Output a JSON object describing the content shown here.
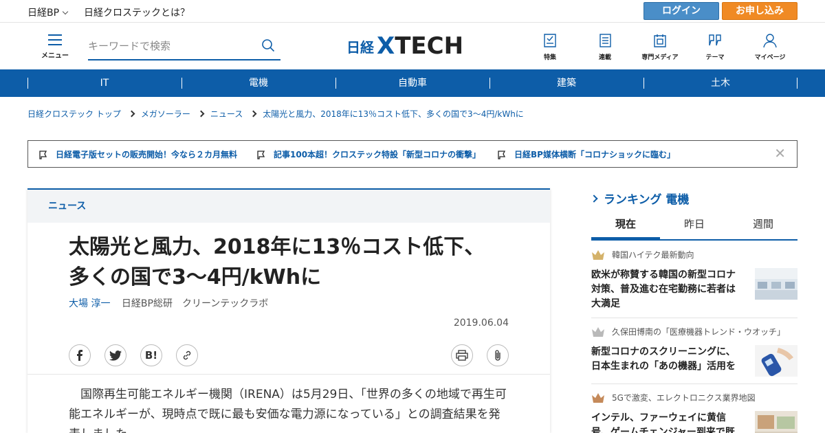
{
  "topbar": {
    "brand_link": "日経BP",
    "about_link": "日経クロステックとは？",
    "login_label": "ログイン",
    "signup_label": "お申し込み"
  },
  "header": {
    "menu_label": "メニュー",
    "search_placeholder": "キーワードで検索",
    "logo_prefix": "日経",
    "logo_x": "X",
    "logo_main": "TECH",
    "nav": [
      {
        "label": "特集",
        "icon": "feature-icon"
      },
      {
        "label": "連載",
        "icon": "series-icon"
      },
      {
        "label": "専門メディア",
        "icon": "media-icon"
      },
      {
        "label": "テーマ",
        "icon": "theme-icon"
      },
      {
        "label": "マイページ",
        "icon": "user-icon"
      }
    ]
  },
  "categories": [
    "IT",
    "電機",
    "自動車",
    "建築",
    "土木"
  ],
  "breadcrumb": [
    "日経クロステック トップ",
    "メガソーラー",
    "ニュース",
    "太陽光と風力、2018年に13％コスト低下、多くの国で3～4円/kWhに"
  ],
  "notices": [
    "日経電子版セットの販売開始！今なら２カ月無料",
    "記事100本超！クロステック特設「新型コロナの衝撃」",
    "日経BP媒体横断「コロナショックに臨む」"
  ],
  "article": {
    "kind": "ニュース",
    "title_line1": "太陽光と風力、2018年に13％コスト低下、",
    "title_line2": "多くの国で3～4円/kWhに",
    "author": "大場 淳一",
    "affiliation": "日経BP総研　クリーンテックラボ",
    "date": "2019.06.04",
    "share_icons": [
      "facebook-icon",
      "twitter-icon",
      "hatena-bookmark-icon",
      "link-icon"
    ],
    "tool_icons": [
      "print-icon",
      "clip-icon"
    ],
    "body": "　国際再生可能エネルギー機関（IRENA）は5月29日、「世界の多くの地域で再生可能エネルギーが、現時点で既に最も安価な電力源になっている」との調査結果を発表しました。"
  },
  "ranking": {
    "title": "ランキング 電機",
    "tabs": [
      "現在",
      "昨日",
      "週間"
    ],
    "active_tab": "現在",
    "items": [
      {
        "rank": 1,
        "source": "韓国ハイテク最新動向",
        "title": "欧米が称賛する韓国の新型コロナ対策、普及進む在宅勤務に若者は大満足",
        "crown_color": "#d4b26a"
      },
      {
        "rank": 2,
        "source": "久保田博南の「医療機器トレンド・ウオッチ」",
        "title": "新型コロナのスクリーニングに、日本生まれの「あの機器」活用を",
        "crown_color": "#b9b9b9"
      },
      {
        "rank": 3,
        "source": "5Gで激変、エレクトロニクス業界地図",
        "title": "インテル、ファーウェイに黄信号、ゲームチェンジャー到来で既",
        "crown_color": "#c58a5a"
      }
    ]
  },
  "colors": {
    "brand_blue": "#0d5da8",
    "login_blue": "#4a8ec8",
    "signup_orange": "#f08a24"
  }
}
